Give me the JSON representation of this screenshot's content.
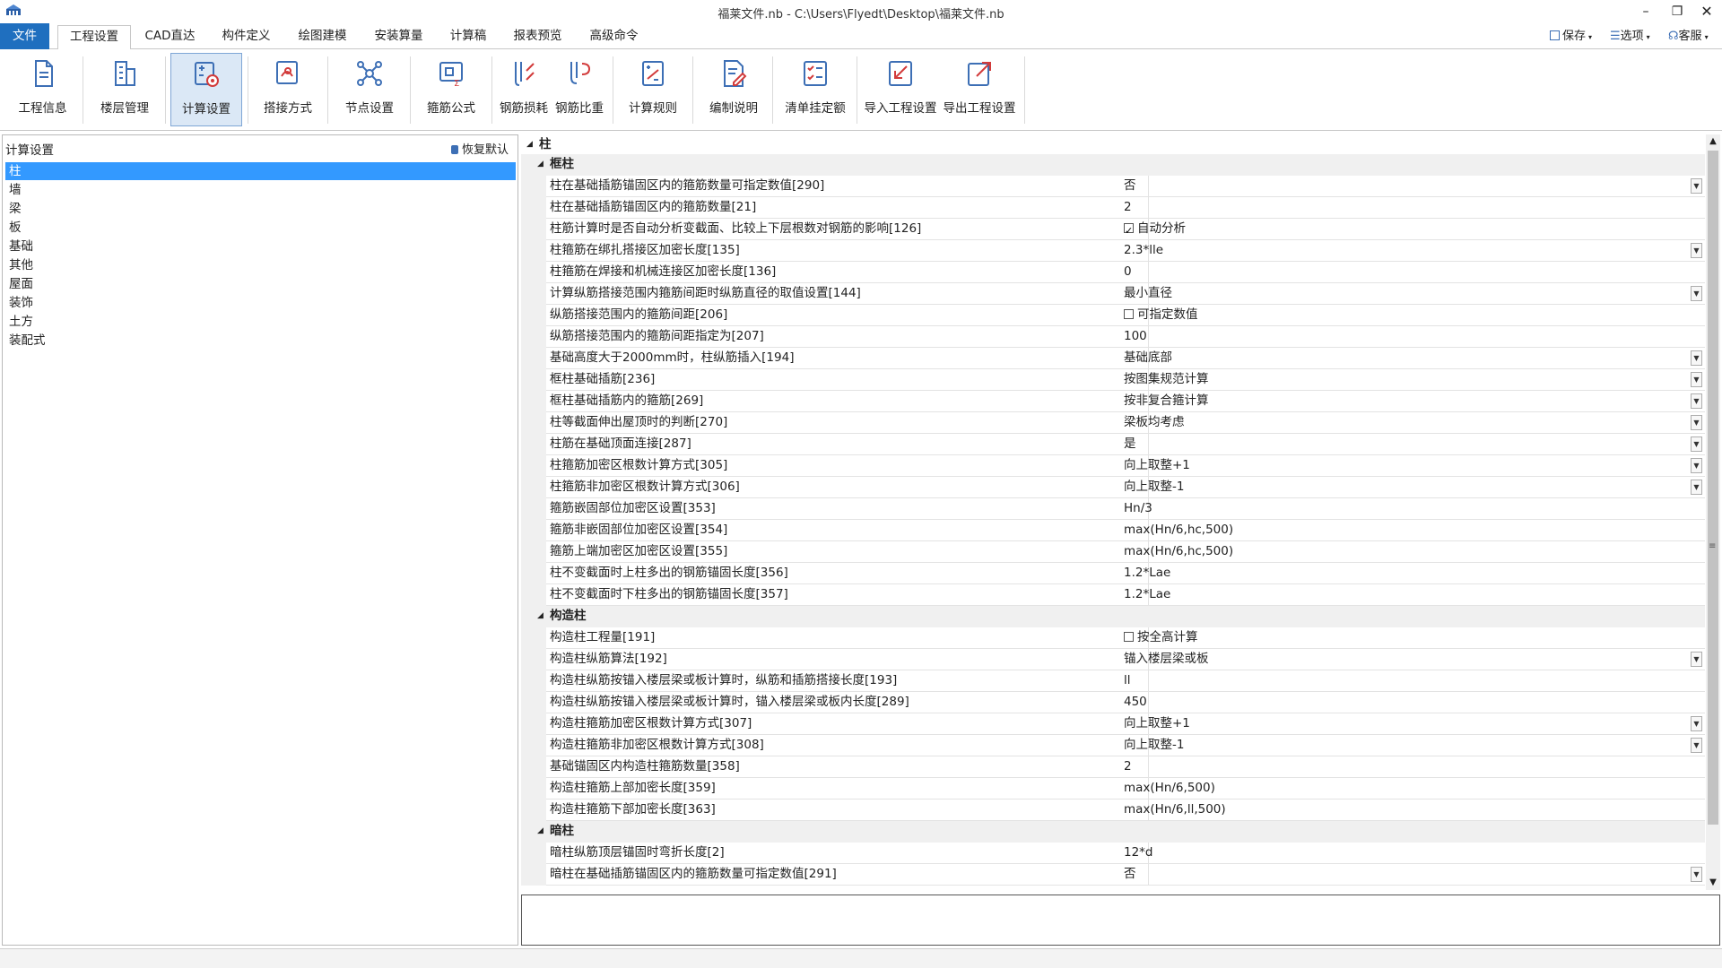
{
  "window": {
    "title": "福莱文件.nb - C:\\Users\\Flyedt\\Desktop\\福莱文件.nb",
    "minimize": "–",
    "maximize": "❐",
    "close": "✕"
  },
  "menu": {
    "tabs": [
      "文件",
      "工程设置",
      "CAD直达",
      "构件定义",
      "绘图建模",
      "安装算量",
      "计算稿",
      "报表预览",
      "高级命令"
    ],
    "active_index": 1,
    "right": {
      "save": "保存",
      "options": "选项",
      "service": "客服"
    }
  },
  "ribbon": {
    "buttons": [
      {
        "label": "工程信息",
        "icon": "document-icon"
      },
      {
        "label": "楼层管理",
        "icon": "building-icon"
      },
      {
        "label": "计算设置",
        "icon": "calc-settings-icon"
      },
      {
        "label": "搭接方式",
        "icon": "lap-joint-icon"
      },
      {
        "label": "节点设置",
        "icon": "node-icon"
      },
      {
        "label": "箍筋公式",
        "icon": "stirrup-formula-icon"
      },
      {
        "label": "钢筋损耗",
        "icon": "rebar-loss-icon"
      },
      {
        "label": "钢筋比重",
        "icon": "rebar-weight-icon"
      },
      {
        "label": "计算规则",
        "icon": "calc-rules-icon"
      },
      {
        "label": "编制说明",
        "icon": "edit-notes-icon"
      },
      {
        "label": "清单挂定额",
        "icon": "list-quota-icon"
      },
      {
        "label": "导入工程设置",
        "icon": "import-icon"
      },
      {
        "label": "导出工程设置",
        "icon": "export-icon"
      }
    ],
    "active_index": 2
  },
  "left_panel": {
    "title": "计算设置",
    "restore_label": "恢复默认",
    "items": [
      "柱",
      "墙",
      "梁",
      "板",
      "基础",
      "其他",
      "屋面",
      "装饰",
      "土方",
      "装配式"
    ],
    "selected_index": 0
  },
  "grid": {
    "root": "柱",
    "sections": [
      {
        "title": "框柱",
        "rows": [
          {
            "name": "柱在基础插筋锚固区内的箍筋数量可指定数值[290]",
            "value": "否",
            "type": "dropdown"
          },
          {
            "name": "柱在基础插筋锚固区内的箍筋数量[21]",
            "value": "2",
            "type": "text"
          },
          {
            "name": "柱筋计算时是否自动分析变截面、比较上下层根数对钢筋的影响[126]",
            "value": "自动分析",
            "type": "checkbox",
            "checked": true
          },
          {
            "name": "柱箍筋在绑扎搭接区加密长度[135]",
            "value": "2.3*lle",
            "type": "dropdown"
          },
          {
            "name": "柱箍筋在焊接和机械连接区加密长度[136]",
            "value": "0",
            "type": "text"
          },
          {
            "name": "计算纵筋搭接范围内箍筋间距时纵筋直径的取值设置[144]",
            "value": "最小直径",
            "type": "dropdown"
          },
          {
            "name": "纵筋搭接范围内的箍筋间距[206]",
            "value": "可指定数值",
            "type": "checkbox",
            "checked": false
          },
          {
            "name": "纵筋搭接范围内的箍筋间距指定为[207]",
            "value": "100",
            "type": "text"
          },
          {
            "name": "基础高度大于2000mm时，柱纵筋插入[194]",
            "value": "基础底部",
            "type": "dropdown"
          },
          {
            "name": "框柱基础插筋[236]",
            "value": "按图集规范计算",
            "type": "dropdown"
          },
          {
            "name": "框柱基础插筋内的箍筋[269]",
            "value": "按非复合箍计算",
            "type": "dropdown"
          },
          {
            "name": "柱等截面伸出屋顶时的判断[270]",
            "value": "梁板均考虑",
            "type": "dropdown"
          },
          {
            "name": "柱筋在基础顶面连接[287]",
            "value": "是",
            "type": "dropdown"
          },
          {
            "name": "柱箍筋加密区根数计算方式[305]",
            "value": "向上取整+1",
            "type": "dropdown"
          },
          {
            "name": "柱箍筋非加密区根数计算方式[306]",
            "value": "向上取整-1",
            "type": "dropdown"
          },
          {
            "name": "箍筋嵌固部位加密区设置[353]",
            "value": "Hn/3",
            "type": "text"
          },
          {
            "name": "箍筋非嵌固部位加密区设置[354]",
            "value": "max(Hn/6,hc,500)",
            "type": "text"
          },
          {
            "name": "箍筋上端加密区加密区设置[355]",
            "value": "max(Hn/6,hc,500)",
            "type": "text"
          },
          {
            "name": "柱不变截面时上柱多出的钢筋锚固长度[356]",
            "value": "1.2*Lae",
            "type": "text"
          },
          {
            "name": "柱不变截面时下柱多出的钢筋锚固长度[357]",
            "value": "1.2*Lae",
            "type": "text"
          }
        ]
      },
      {
        "title": "构造柱",
        "rows": [
          {
            "name": "构造柱工程量[191]",
            "value": "按全高计算",
            "type": "checkbox",
            "checked": false
          },
          {
            "name": "构造柱纵筋算法[192]",
            "value": "锚入楼层梁或板",
            "type": "dropdown"
          },
          {
            "name": "构造柱纵筋按锚入楼层梁或板计算时，纵筋和插筋搭接长度[193]",
            "value": "ll",
            "type": "text"
          },
          {
            "name": "构造柱纵筋按锚入楼层梁或板计算时，锚入楼层梁或板内长度[289]",
            "value": "450",
            "type": "text"
          },
          {
            "name": "构造柱箍筋加密区根数计算方式[307]",
            "value": "向上取整+1",
            "type": "dropdown"
          },
          {
            "name": "构造柱箍筋非加密区根数计算方式[308]",
            "value": "向上取整-1",
            "type": "dropdown"
          },
          {
            "name": "基础锚固区内构造柱箍筋数量[358]",
            "value": "2",
            "type": "text"
          },
          {
            "name": "构造柱箍筋上部加密长度[359]",
            "value": "max(Hn/6,500)",
            "type": "text"
          },
          {
            "name": "构造柱箍筋下部加密长度[363]",
            "value": "max(Hn/6,ll,500)",
            "type": "text"
          }
        ]
      },
      {
        "title": "暗柱",
        "rows": [
          {
            "name": "暗柱纵筋顶层锚固时弯折长度[2]",
            "value": "12*d",
            "type": "text"
          },
          {
            "name": "暗柱在基础插筋锚固区内的箍筋数量可指定数值[291]",
            "value": "否",
            "type": "dropdown"
          }
        ]
      }
    ]
  }
}
